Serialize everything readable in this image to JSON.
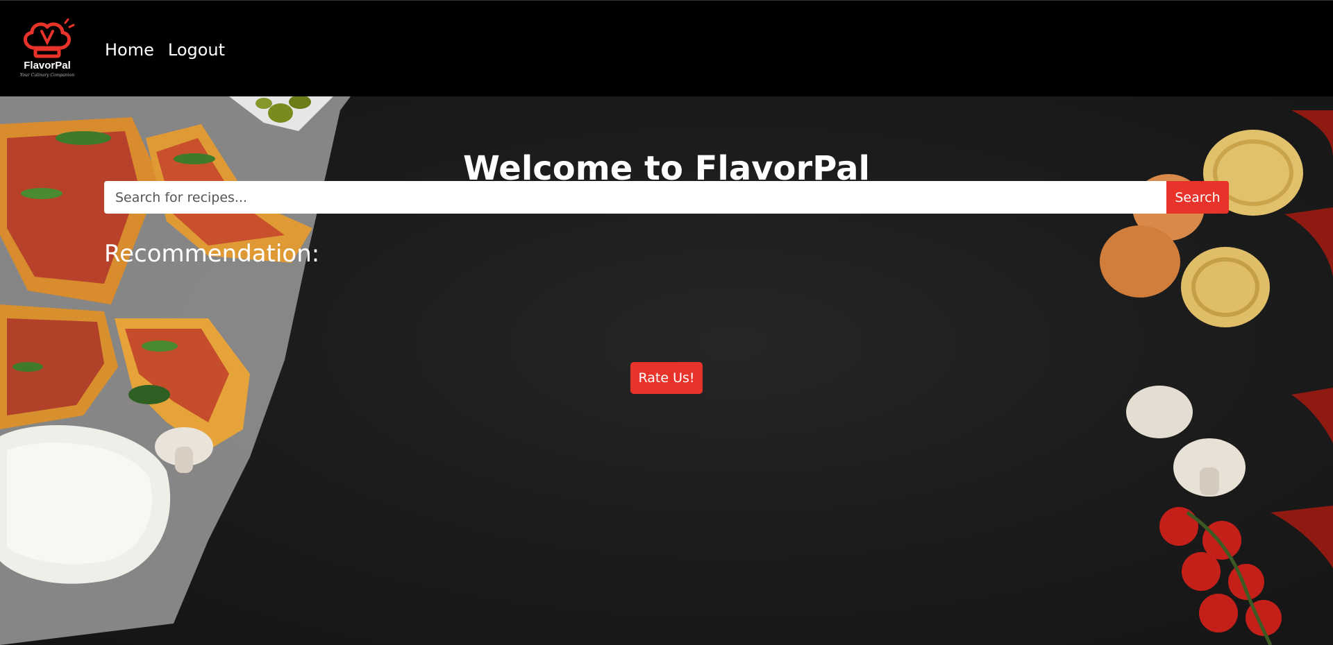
{
  "brand": {
    "name": "FlavorPal",
    "tagline": "Your Culinary Companion",
    "accent_color": "#e8332a",
    "logo_icon": "chef-hat-icon"
  },
  "nav": {
    "items": [
      {
        "label": "Home"
      },
      {
        "label": "Logout"
      }
    ]
  },
  "hero": {
    "title": "Welcome to FlavorPal",
    "search": {
      "placeholder": "Search for recipes...",
      "value": "",
      "button_label": "Search"
    },
    "recommendation_heading": "Recommendation:",
    "rate_button_label": "Rate Us!"
  }
}
